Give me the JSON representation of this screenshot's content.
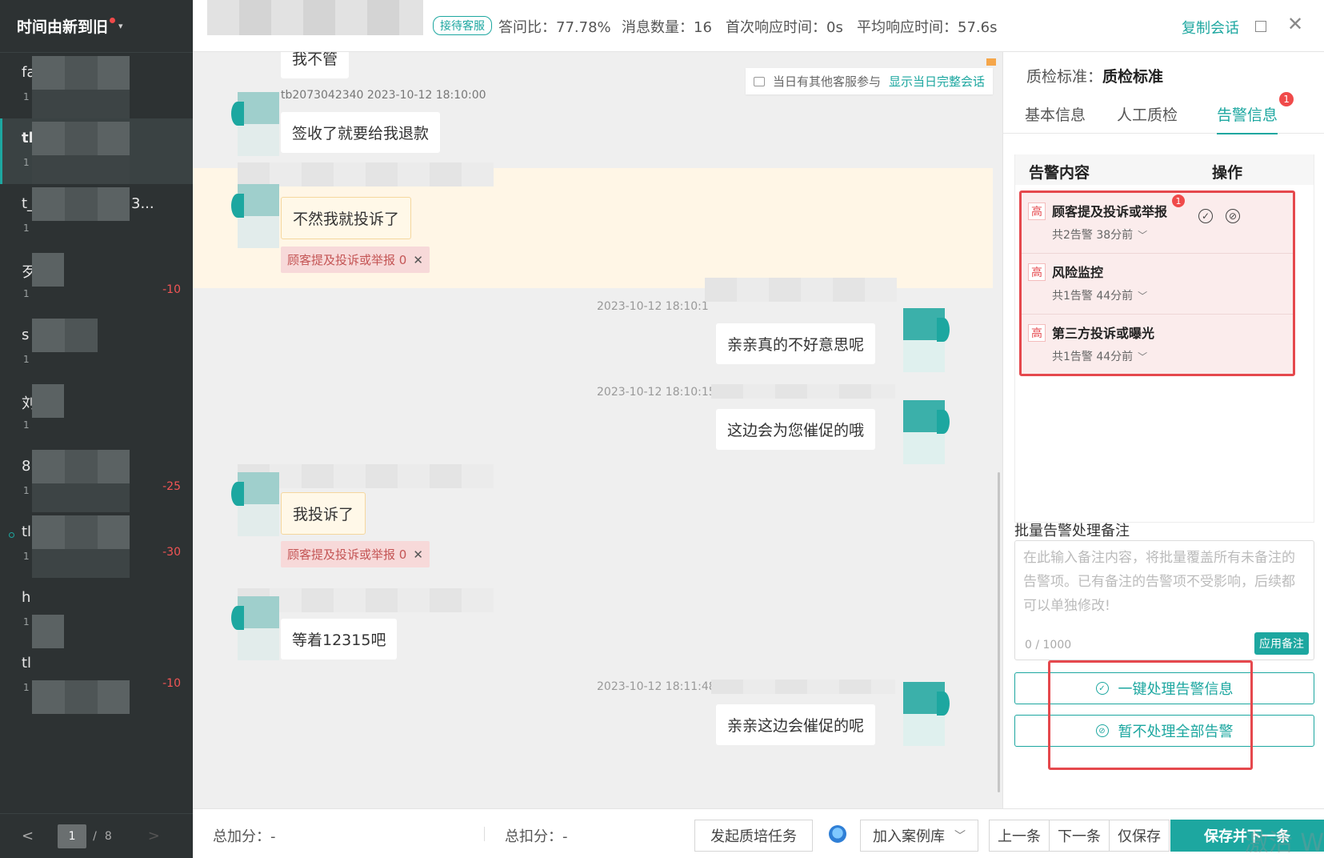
{
  "sidebar": {
    "sort_label": "时间由新到旧",
    "sessions": [
      {
        "prefix": "fa",
        "num": "1",
        "score": ""
      },
      {
        "prefix": "tl",
        "num": "1",
        "score": ""
      },
      {
        "prefix": "t_",
        "num": "1",
        "score": "",
        "suffix": "3..."
      },
      {
        "prefix": "歹",
        "num": "1",
        "score": "-10"
      },
      {
        "prefix": "s",
        "num": "1",
        "score": ""
      },
      {
        "prefix": "刘",
        "num": "1",
        "score": ""
      },
      {
        "prefix": "8",
        "num": "1",
        "score": "-25"
      },
      {
        "prefix": "tl",
        "num": "1",
        "score": "-30"
      },
      {
        "prefix": "h",
        "num": "1",
        "score": ""
      },
      {
        "prefix": "tl",
        "num": "1",
        "score": "-10"
      }
    ],
    "pager": {
      "current": "1",
      "sep": "/",
      "total": "8"
    }
  },
  "topbar": {
    "badge": "接待客服",
    "answer_ratio": "答问比：77.78%",
    "msg_count": "消息数量：16",
    "first_resp": "首次响应时间：0s",
    "avg_resp": "平均响应时间：57.6s",
    "copy_label": "复制会话"
  },
  "chat": {
    "notice_text": "当日有其他客服参与",
    "notice_link": "显示当日完整会话",
    "top_partial": "我不管",
    "sender_partial": "tb2073042340  2023-10-12 18:10:00",
    "messages": [
      {
        "text": "签收了就要给我退款"
      },
      {
        "text": "不然我就投诉了",
        "tag": "顾客提及投诉或举报 0"
      },
      {
        "time": "2023-10-12 18:10:1",
        "text": "亲亲真的不好意思呢"
      },
      {
        "time": "2023-10-12 18:10:15",
        "text": "这边会为您催促的哦"
      },
      {
        "text": "我投诉了",
        "tag": "顾客提及投诉或举报 0"
      },
      {
        "text": "等着12315吧"
      },
      {
        "time": "2023-10-12 18:11:48",
        "text": "亲亲这边会催促的呢"
      }
    ]
  },
  "bottombar": {
    "total_add": "总加分：-",
    "total_deduct": "总扣分：-",
    "train_task": "发起质培任务",
    "add_case": "加入案例库",
    "prev": "上一条",
    "next": "下一条",
    "save_only": "仅保存",
    "save_next": "保存并下一条"
  },
  "rpanel": {
    "std_label": "质检标准：",
    "std_value": "质检标准",
    "tabs": [
      "基本信息",
      "人工质检",
      "告警信息"
    ],
    "tab_badge": "1",
    "table_head": {
      "content": "告警内容",
      "op": "操作"
    },
    "alerts": [
      {
        "level": "高",
        "title": "顾客提及投诉或举报",
        "sub": "共2告警 38分前",
        "badge": "1"
      },
      {
        "level": "高",
        "title": "风险监控",
        "sub": "共1告警 44分前"
      },
      {
        "level": "高",
        "title": "第三方投诉或曝光",
        "sub": "共1告警 44分前"
      }
    ],
    "batch_label": "批量告警处理备注",
    "batch_placeholder": "在此输入备注内容，将批量覆盖所有未备注的告警项。已有备注的告警项不受影响，后续都可以单独修改!",
    "batch_count": "0 / 1000",
    "apply_label": "应用备注",
    "one_click": "一键处理告警信息",
    "skip_all": "暂不处理全部告警"
  },
  "watermark": "激活 W",
  "colors": {
    "accent": "#1da7a0",
    "alert": "#e5484d",
    "sidebar": "#2d3233"
  }
}
